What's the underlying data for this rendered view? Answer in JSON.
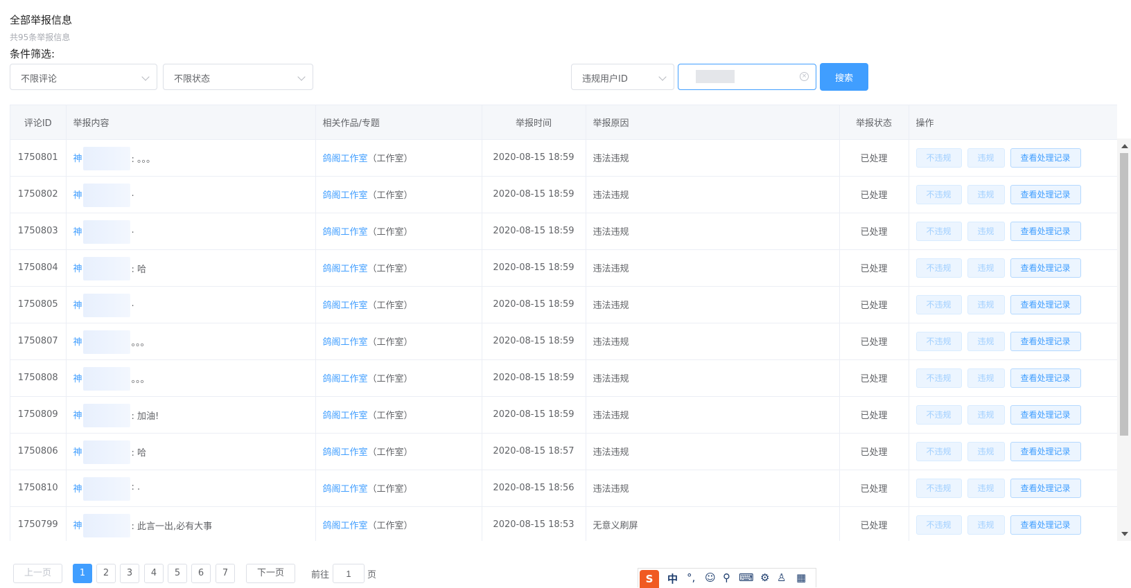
{
  "header": {
    "title": "全部举报信息",
    "subtitle": "共95条举报信息",
    "filter_label": "条件筛选:"
  },
  "filters": {
    "comment_type": "不限评论",
    "status": "不限状态",
    "search_field": "违规用户ID",
    "search_value": "",
    "search_button": "搜索"
  },
  "table": {
    "columns": [
      "评论ID",
      "举报内容",
      "相关作品/专题",
      "举报时间",
      "举报原因",
      "举报状态",
      "操作"
    ],
    "rows": [
      {
        "id": "1750801",
        "content_link": "神",
        "content_text": ": 。。。",
        "work": "鸽阁工作室",
        "work_suffix": "（工作室）",
        "time": "2020-08-15 18:59",
        "reason": "违法违规",
        "status": "已处理"
      },
      {
        "id": "1750802",
        "content_link": "神",
        "content_text": ".",
        "work": "鸽阁工作室",
        "work_suffix": "（工作室）",
        "time": "2020-08-15 18:59",
        "reason": "违法违规",
        "status": "已处理"
      },
      {
        "id": "1750803",
        "content_link": "神",
        "content_text": ".",
        "work": "鸽阁工作室",
        "work_suffix": "（工作室）",
        "time": "2020-08-15 18:59",
        "reason": "违法违规",
        "status": "已处理"
      },
      {
        "id": "1750804",
        "content_link": "神",
        "content_text": ": 哈",
        "work": "鸽阁工作室",
        "work_suffix": "（工作室）",
        "time": "2020-08-15 18:59",
        "reason": "违法违规",
        "status": "已处理"
      },
      {
        "id": "1750805",
        "content_link": "神",
        "content_text": ".",
        "work": "鸽阁工作室",
        "work_suffix": "（工作室）",
        "time": "2020-08-15 18:59",
        "reason": "违法违规",
        "status": "已处理"
      },
      {
        "id": "1750807",
        "content_link": "神",
        "content_text": "。。。",
        "work": "鸽阁工作室",
        "work_suffix": "（工作室）",
        "time": "2020-08-15 18:59",
        "reason": "违法违规",
        "status": "已处理"
      },
      {
        "id": "1750808",
        "content_link": "神",
        "content_text": "。。。",
        "work": "鸽阁工作室",
        "work_suffix": "（工作室）",
        "time": "2020-08-15 18:59",
        "reason": "违法违规",
        "status": "已处理"
      },
      {
        "id": "1750809",
        "content_link": "神",
        "content_text": ": 加油!",
        "work": "鸽阁工作室",
        "work_suffix": "（工作室）",
        "time": "2020-08-15 18:59",
        "reason": "违法违规",
        "status": "已处理"
      },
      {
        "id": "1750806",
        "content_link": "神",
        "content_text": ": 哈",
        "work": "鸽阁工作室",
        "work_suffix": "（工作室）",
        "time": "2020-08-15 18:57",
        "reason": "违法违规",
        "status": "已处理"
      },
      {
        "id": "1750810",
        "content_link": "神",
        "content_text": ": .",
        "work": "鸽阁工作室",
        "work_suffix": "（工作室）",
        "time": "2020-08-15 18:56",
        "reason": "违法违规",
        "status": "已处理"
      },
      {
        "id": "1750799",
        "content_link": "神",
        "content_text": ": 此言一出,必有大事",
        "work": "鸽阁工作室",
        "work_suffix": "（工作室）",
        "time": "2020-08-15 18:53",
        "reason": "无意义刷屏",
        "status": "已处理"
      }
    ],
    "actions": {
      "not_violation": "不违规",
      "violation": "违规",
      "view_log": "查看处理记录"
    }
  },
  "pagination": {
    "prev": "上一页",
    "pages": [
      "1",
      "2",
      "3",
      "4",
      "5",
      "6",
      "7"
    ],
    "active_page": "1",
    "next": "下一页",
    "goto_prefix": "前往",
    "goto_value": "1",
    "goto_suffix": "页"
  },
  "ime_bar": {
    "logo": "S",
    "mode": "中",
    "punct": "°,",
    "icons": [
      "smiley-icon",
      "microphone-icon",
      "keyboard-icon",
      "tools-icon",
      "shirt-icon",
      "grid-icon"
    ]
  },
  "colors": {
    "primary": "#409eff",
    "border": "#dcdfe6",
    "header_bg": "#f5f7fa"
  }
}
